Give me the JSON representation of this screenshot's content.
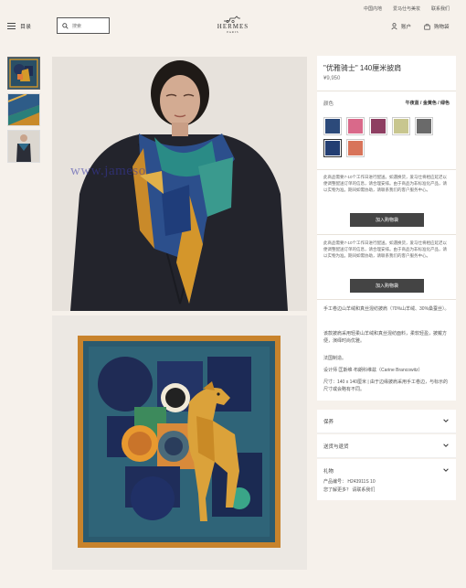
{
  "header": {
    "top_links": [
      "中国内地",
      "爱马仕与美妆",
      "联系我们"
    ],
    "menu_label": "目录",
    "search_placeholder": "搜索",
    "logo_name": "HERMES",
    "logo_city": "PARIS",
    "account_label": "账户",
    "cart_label": "购物袋"
  },
  "watermark": "www.jameso",
  "product": {
    "title": "\"优雅骑士\" 140厘米披肩",
    "price": "¥9,950",
    "color_label": "颜色",
    "color_value": "午夜蓝 / 金黄色 / 绿色",
    "swatch_colors": [
      "#2c4a7a",
      "#d9698a",
      "#8e3f62",
      "#c8c68f",
      "#6a6a6a",
      "#233e73",
      "#d8745a"
    ],
    "note_1": "此商品需要7-10个工作日进行配送。如遇换货，爱马仕将相应延迟以便调整配送订单的信息，请合理安排。由于商品为非标准化产品，请以实物为准。期间如需协助，请联系我们的客户服务中心。",
    "add_button_1": "加入购物袋",
    "note_2": "此商品需要7-10个工作日进行配送。如遇换货，爱马仕将相应延迟以便调整配送订单的信息，请合理安排。由于商品为非标准化产品，请以实物为准。期间如需协助，请联系我们的客户服务中心。",
    "add_button_2": "加入购物袋",
    "desc_1": "手工卷边山羊绒和真丝混纺披肩（70%山羊绒、30%桑蚕丝）。",
    "desc_2": "该款披肩采用轻柔山羊绒和真丝混纺面料，柔软轻盈，披戴方便，演绎时尚优雅。",
    "desc_3": "法国制造。",
    "desc_4": "设计师 匡斯维·布朗科维兹（Carine Brancowitz）",
    "desc_5": "尺寸：140 x 140厘米 | 由于边缘披肩采用手工卷边，与标示的尺寸或会略有不同。"
  },
  "accordion": {
    "items": [
      "保养",
      "送货与退货",
      "礼物"
    ],
    "product_number": "产品编号：    H243911S 10",
    "help_text": "您了解更多？ 请联系我们"
  }
}
